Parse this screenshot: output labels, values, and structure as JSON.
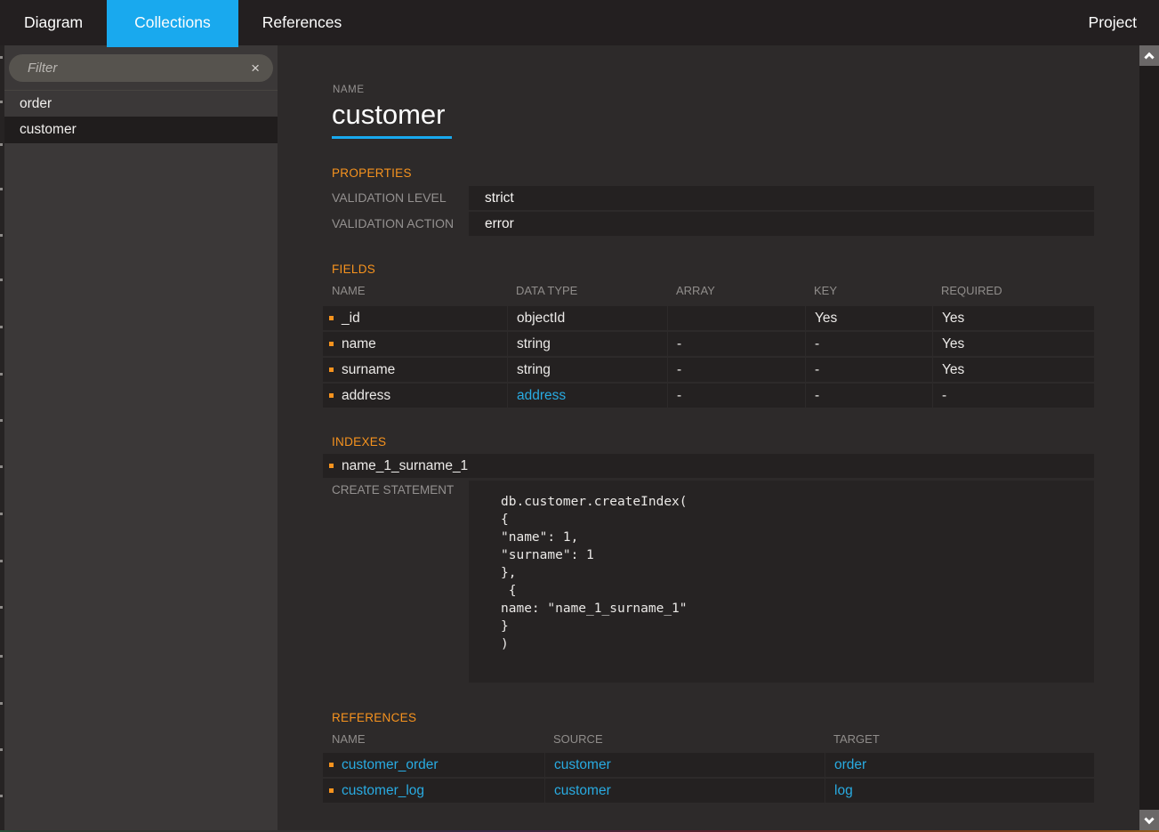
{
  "topbar": {
    "tabs": [
      {
        "label": "Diagram"
      },
      {
        "label": "Collections"
      },
      {
        "label": "References"
      }
    ],
    "project_label": "Project"
  },
  "sidebar": {
    "filter_placeholder": "Filter",
    "clear_icon": "×",
    "items": [
      {
        "label": "order"
      },
      {
        "label": "customer"
      }
    ]
  },
  "detail": {
    "name_label": "NAME",
    "name_value": "customer",
    "properties": {
      "title": "PROPERTIES",
      "rows": [
        {
          "label": "VALIDATION LEVEL",
          "value": "strict"
        },
        {
          "label": "VALIDATION ACTION",
          "value": "error"
        }
      ]
    },
    "fields": {
      "title": "FIELDS",
      "columns": [
        "NAME",
        "DATA TYPE",
        "ARRAY",
        "KEY",
        "REQUIRED"
      ],
      "rows": [
        {
          "name": "_id",
          "data_type": "objectId",
          "array": "",
          "key": "Yes",
          "required": "Yes"
        },
        {
          "name": "name",
          "data_type": "string",
          "array": "-",
          "key": "-",
          "required": "Yes"
        },
        {
          "name": "surname",
          "data_type": "string",
          "array": "-",
          "key": "-",
          "required": "Yes"
        },
        {
          "name": "address",
          "data_type": "address",
          "array": "-",
          "key": "-",
          "required": "-"
        }
      ]
    },
    "indexes": {
      "title": "INDEXES",
      "items": [
        "name_1_surname_1"
      ],
      "create_statement_label": "CREATE STATEMENT",
      "create_statement_code": "db.customer.createIndex(\n{\n\"name\": 1,\n\"surname\": 1\n},\n {\nname: \"name_1_surname_1\"\n}\n)"
    },
    "references": {
      "title": "REFERENCES",
      "columns": [
        "NAME",
        "SOURCE",
        "TARGET"
      ],
      "rows": [
        {
          "name": "customer_order",
          "source": "customer",
          "target": "order"
        },
        {
          "name": "customer_log",
          "source": "customer",
          "target": "log"
        }
      ]
    }
  },
  "colors": {
    "accent_blue": "#29abe2",
    "accent_orange": "#f7931e"
  }
}
